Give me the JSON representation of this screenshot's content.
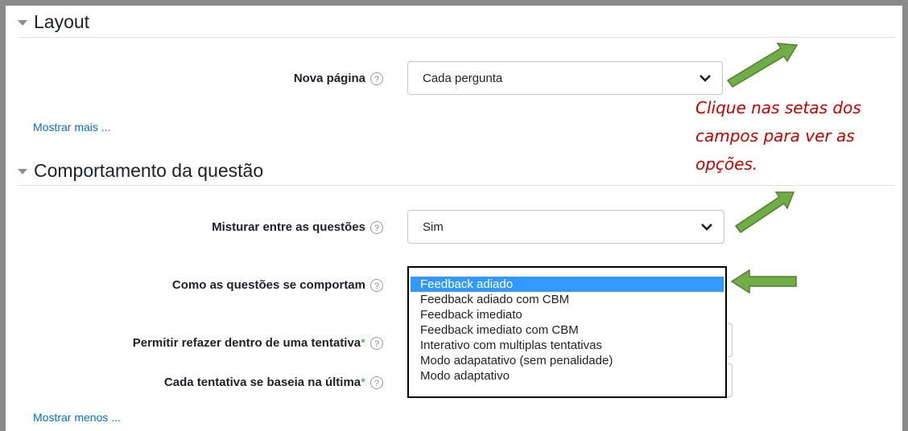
{
  "sections": {
    "layout": {
      "title": "Layout",
      "nova_pagina": {
        "label": "Nova página",
        "value": "Cada pergunta"
      },
      "show_more": "Mostrar mais ..."
    },
    "behaviour": {
      "title": "Comportamento da questão",
      "shuffle": {
        "label": "Misturar entre as questões",
        "value": "Sim"
      },
      "how_behave": {
        "label": "Como as questões se comportam",
        "options": [
          "Feedback adiado",
          "Feedback adiado com CBM",
          "Feedback imediato",
          "Feedback imediato com CBM",
          "Interativo com multiplas tentativas",
          "Modo adapatativo (sem penalidade)",
          "Modo adaptativo"
        ],
        "selected_index": 0
      },
      "redo": {
        "label": "Permitir refazer dentro de uma tentativa",
        "required_mark": "*"
      },
      "each_attempt": {
        "label": "Cada tentativa se baseia na última",
        "required_mark": "*"
      },
      "show_less": "Mostrar menos ..."
    }
  },
  "help_glyph": "?",
  "annotation": {
    "lines": [
      "Clique nas setas dos",
      "campos para ver as",
      "opções."
    ],
    "color": "#c00000"
  },
  "colors": {
    "link": "#0f6cbf",
    "arrow_fill": "#70ad47",
    "arrow_stroke": "#507e32",
    "selection": "#3399ff"
  }
}
